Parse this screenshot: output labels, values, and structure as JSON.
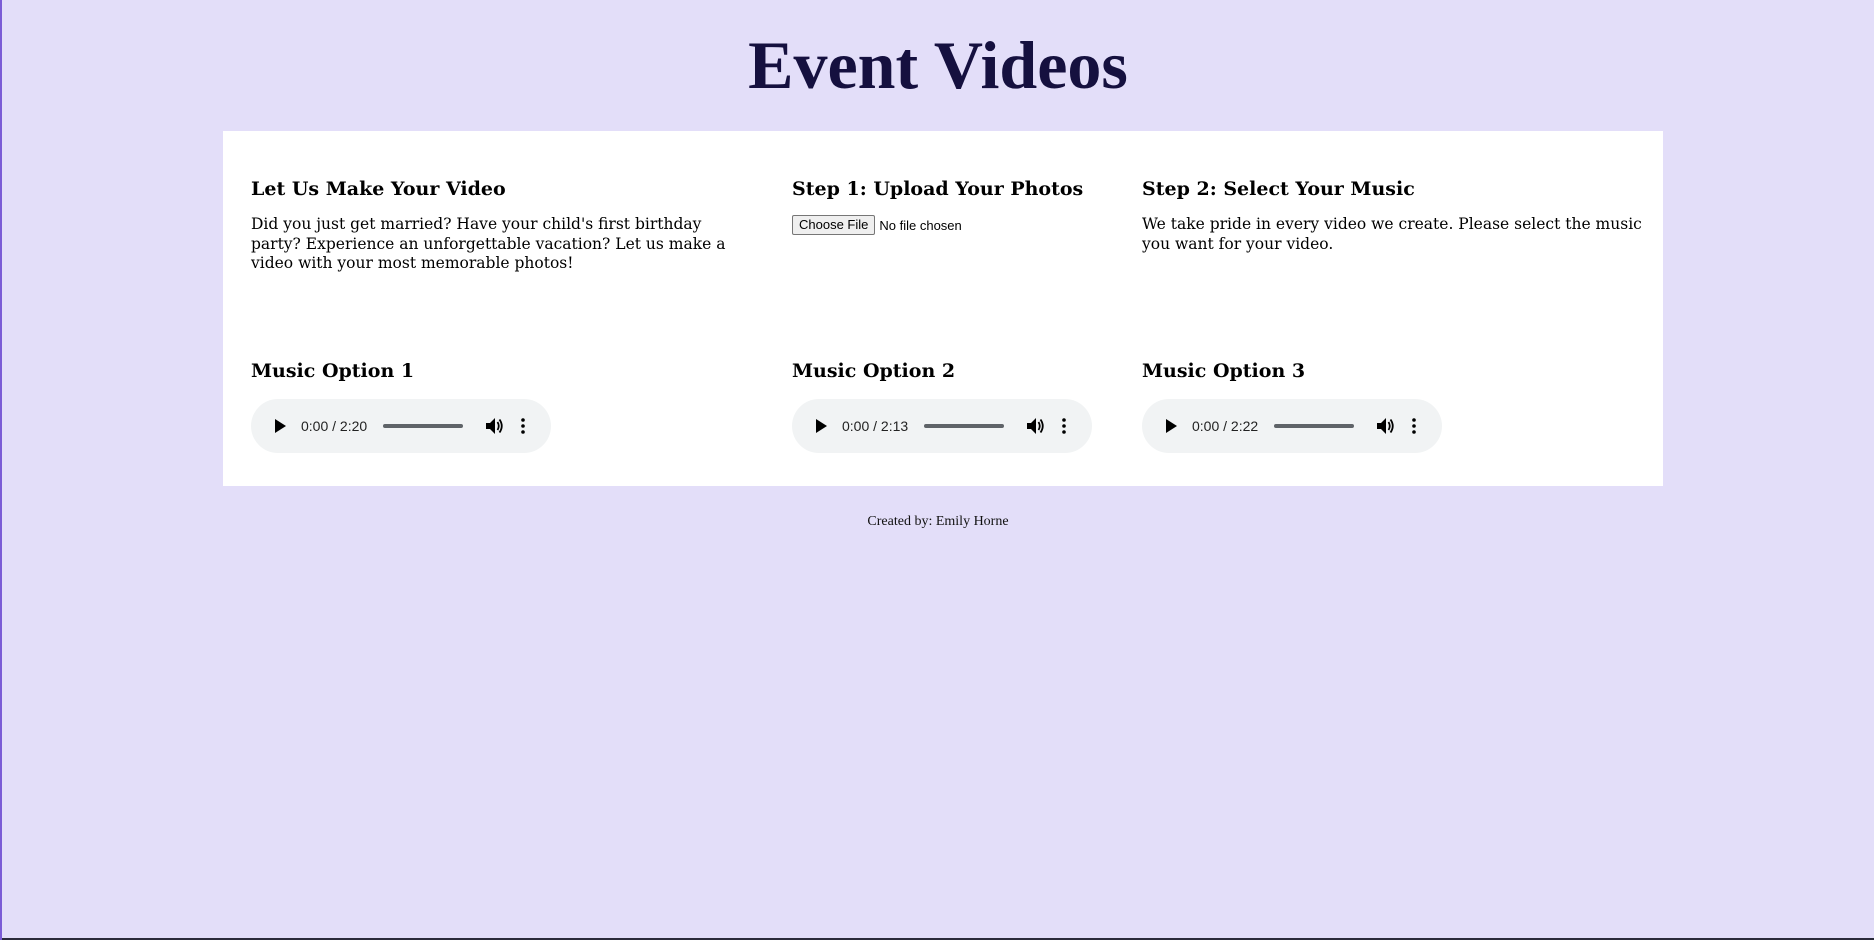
{
  "page": {
    "title": "Event Videos"
  },
  "intro": {
    "heading": "Let Us Make Your Video",
    "text": "Did you just get married? Have your child's first birthday party? Experience an unforgettable vacation? Let us make a video with your most memorable photos!"
  },
  "upload": {
    "heading": "Step 1: Upload Your Photos",
    "button_label": "Choose File",
    "status": "No file chosen"
  },
  "music": {
    "heading": "Step 2: Select Your Music",
    "text": "We take pride in every video we create. Please select the music you want for your video."
  },
  "options": [
    {
      "heading": "Music Option 1",
      "time": "0:00 / 2:20"
    },
    {
      "heading": "Music Option 2",
      "time": "0:00 / 2:13"
    },
    {
      "heading": "Music Option 3",
      "time": "0:00 / 2:22"
    }
  ],
  "footer": {
    "text": "Created by: Emily Horne"
  },
  "colors": {
    "background": "#e3def9",
    "title": "#15103f",
    "panel": "#ffffff",
    "player": "#f1f3f4"
  },
  "icons": [
    "play-icon",
    "volume-icon",
    "more-vert-icon"
  ]
}
